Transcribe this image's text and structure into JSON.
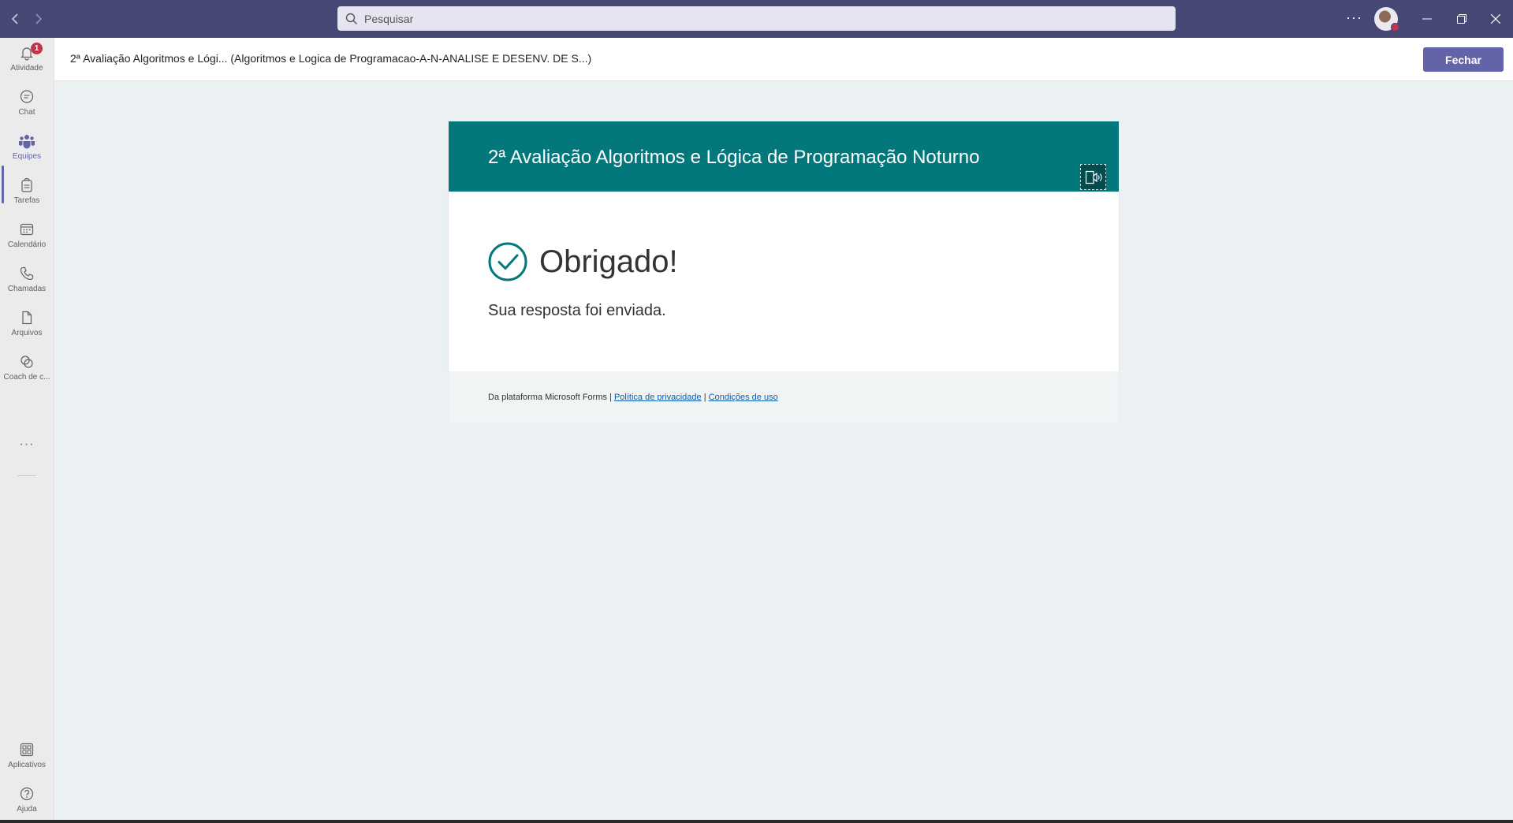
{
  "titlebar": {
    "search_placeholder": "Pesquisar",
    "more_label": "···"
  },
  "rail": {
    "items": [
      {
        "label": "Atividade",
        "icon": "bell-icon",
        "badge": "1"
      },
      {
        "label": "Chat",
        "icon": "chat-icon"
      },
      {
        "label": "Equipes",
        "icon": "teams-icon",
        "active": true
      },
      {
        "label": "Tarefas",
        "icon": "tasks-icon"
      },
      {
        "label": "Calendário",
        "icon": "calendar-icon"
      },
      {
        "label": "Chamadas",
        "icon": "phone-icon"
      },
      {
        "label": "Arquivos",
        "icon": "file-icon"
      },
      {
        "label": "Coach de c...",
        "icon": "coach-icon"
      }
    ],
    "more_label": "···",
    "bottom": [
      {
        "label": "Aplicativos",
        "icon": "apps-icon"
      },
      {
        "label": "Ajuda",
        "icon": "help-icon"
      }
    ]
  },
  "header": {
    "title": "2ª Avaliação Algoritmos e Lógi... (Algoritmos e Logica de Programacao-A-N-ANALISE E DESENV. DE S...)",
    "close_label": "Fechar"
  },
  "form": {
    "title": "2ª Avaliação Algoritmos e Lógica de Programação Noturno",
    "thanks": "Obrigado!",
    "submitted": "Sua resposta foi enviada.",
    "footer_prefix": "Da plataforma Microsoft Forms",
    "separator": "|",
    "privacy_link": "Política de privacidade",
    "terms_link": "Condições de uso"
  },
  "colors": {
    "teams_purple": "#464775",
    "accent": "#6264a7",
    "form_header": "#03787c",
    "badge": "#c4314b"
  }
}
